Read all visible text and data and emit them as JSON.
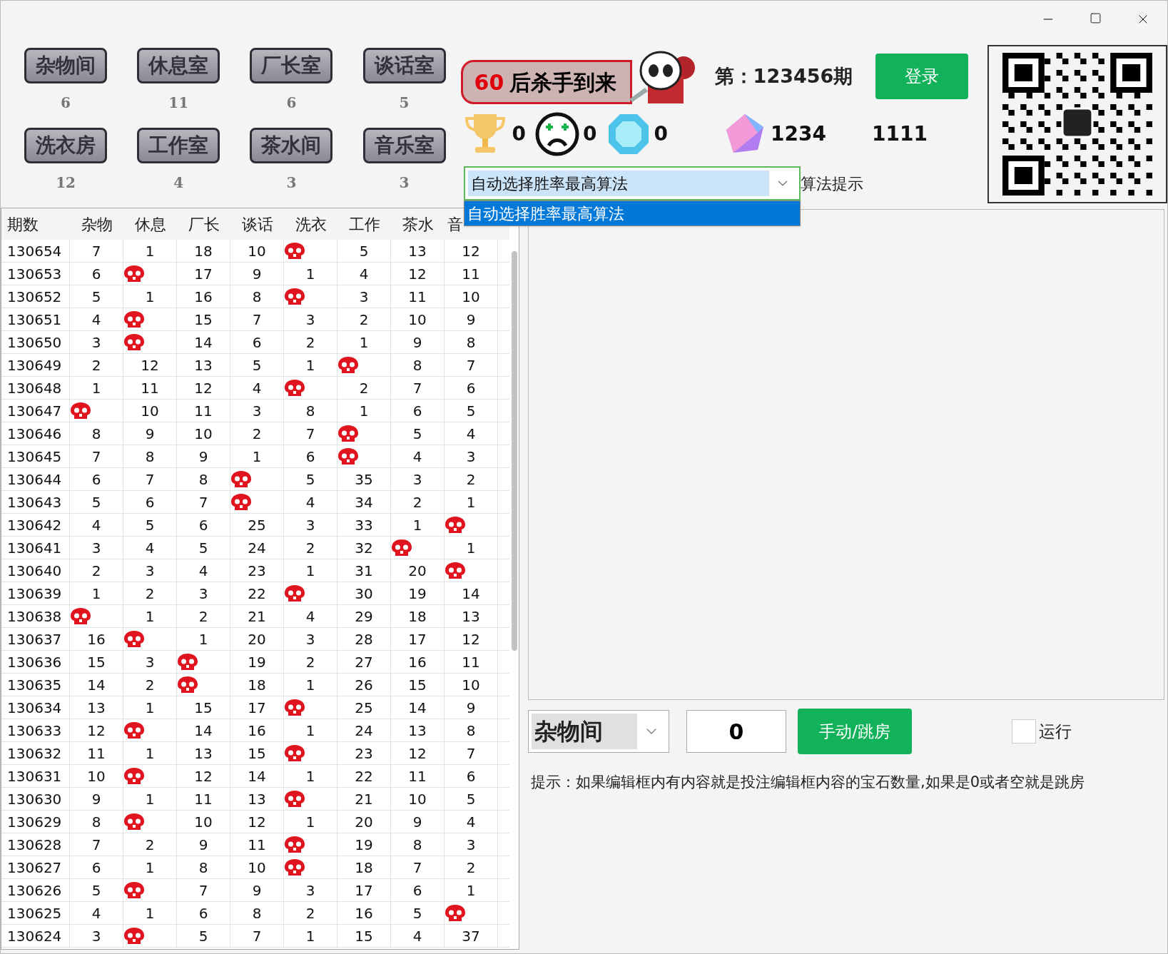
{
  "rooms": [
    {
      "label": "杂物间",
      "count": "6"
    },
    {
      "label": "休息室",
      "count": "11"
    },
    {
      "label": "厂长室",
      "count": "6"
    },
    {
      "label": "谈话室",
      "count": "5"
    },
    {
      "label": "洗衣房",
      "count": "12"
    },
    {
      "label": "工作室",
      "count": "4"
    },
    {
      "label": "茶水间",
      "count": "3"
    },
    {
      "label": "音乐室",
      "count": "3"
    }
  ],
  "banner": {
    "count": "60",
    "text": "后杀手到来"
  },
  "period": "第：123456期",
  "login_button": "登录",
  "stats": [
    {
      "kind": "trophy",
      "value": "0"
    },
    {
      "kind": "sad",
      "value": "0"
    },
    {
      "kind": "gem",
      "value": "0"
    },
    {
      "kind": "crystal",
      "value": "1234"
    }
  ],
  "extra_value": "1111",
  "algorithm": {
    "value": "自动选择胜率最高算法",
    "label": "算法提示",
    "options": [
      {
        "label": "自动选择胜率最高算法",
        "selected": true
      }
    ]
  },
  "table": {
    "columns": [
      "期数",
      "杂物",
      "休息",
      "厂长",
      "谈话",
      "洗衣",
      "工作",
      "茶水",
      "音"
    ],
    "rows": [
      {
        "cells": [
          "130654",
          "7",
          "1",
          "18",
          "10",
          {
            "kind": "skull"
          },
          "5",
          "13",
          "12"
        ]
      },
      {
        "cells": [
          "130653",
          "6",
          {
            "kind": "skull"
          },
          "17",
          "9",
          "1",
          "4",
          "12",
          "11"
        ]
      },
      {
        "cells": [
          "130652",
          "5",
          "1",
          "16",
          "8",
          {
            "kind": "skull"
          },
          "3",
          "11",
          "10"
        ]
      },
      {
        "cells": [
          "130651",
          "4",
          {
            "kind": "skull"
          },
          "15",
          "7",
          "3",
          "2",
          "10",
          "9"
        ]
      },
      {
        "cells": [
          "130650",
          "3",
          {
            "kind": "skull"
          },
          "14",
          "6",
          "2",
          "1",
          "9",
          "8"
        ]
      },
      {
        "cells": [
          "130649",
          "2",
          "12",
          "13",
          "5",
          "1",
          {
            "kind": "skull"
          },
          "8",
          "7"
        ]
      },
      {
        "cells": [
          "130648",
          "1",
          "11",
          "12",
          "4",
          {
            "kind": "skull"
          },
          "2",
          "7",
          "6"
        ]
      },
      {
        "cells": [
          "130647",
          {
            "kind": "skull"
          },
          "10",
          "11",
          "3",
          "8",
          "1",
          "6",
          "5"
        ]
      },
      {
        "cells": [
          "130646",
          "8",
          "9",
          "10",
          "2",
          "7",
          {
            "kind": "skull"
          },
          "5",
          "4"
        ]
      },
      {
        "cells": [
          "130645",
          "7",
          "8",
          "9",
          "1",
          "6",
          {
            "kind": "skull"
          },
          "4",
          "3"
        ]
      },
      {
        "cells": [
          "130644",
          "6",
          "7",
          "8",
          {
            "kind": "skull"
          },
          "5",
          "35",
          "3",
          "2"
        ]
      },
      {
        "cells": [
          "130643",
          "5",
          "6",
          "7",
          {
            "kind": "skull"
          },
          "4",
          "34",
          "2",
          "1"
        ]
      },
      {
        "cells": [
          "130642",
          "4",
          "5",
          "6",
          "25",
          "3",
          "33",
          "1",
          {
            "kind": "skull"
          }
        ]
      },
      {
        "cells": [
          "130641",
          "3",
          "4",
          "5",
          "24",
          "2",
          "32",
          {
            "kind": "skull"
          },
          "1"
        ]
      },
      {
        "cells": [
          "130640",
          "2",
          "3",
          "4",
          "23",
          "1",
          "31",
          "20",
          {
            "kind": "skull"
          }
        ]
      },
      {
        "cells": [
          "130639",
          "1",
          "2",
          "3",
          "22",
          {
            "kind": "skull"
          },
          "30",
          "19",
          "14"
        ]
      },
      {
        "cells": [
          "130638",
          {
            "kind": "skull"
          },
          "1",
          "2",
          "21",
          "4",
          "29",
          "18",
          "13"
        ]
      },
      {
        "cells": [
          "130637",
          "16",
          {
            "kind": "skull"
          },
          "1",
          "20",
          "3",
          "28",
          "17",
          "12"
        ]
      },
      {
        "cells": [
          "130636",
          "15",
          "3",
          {
            "kind": "skull"
          },
          "19",
          "2",
          "27",
          "16",
          "11"
        ]
      },
      {
        "cells": [
          "130635",
          "14",
          "2",
          {
            "kind": "skull"
          },
          "18",
          "1",
          "26",
          "15",
          "10"
        ]
      },
      {
        "cells": [
          "130634",
          "13",
          "1",
          "15",
          "17",
          {
            "kind": "skull"
          },
          "25",
          "14",
          "9"
        ]
      },
      {
        "cells": [
          "130633",
          "12",
          {
            "kind": "skull"
          },
          "14",
          "16",
          "1",
          "24",
          "13",
          "8"
        ]
      },
      {
        "cells": [
          "130632",
          "11",
          "1",
          "13",
          "15",
          {
            "kind": "skull"
          },
          "23",
          "12",
          "7"
        ]
      },
      {
        "cells": [
          "130631",
          "10",
          {
            "kind": "skull"
          },
          "12",
          "14",
          "1",
          "22",
          "11",
          "6"
        ]
      },
      {
        "cells": [
          "130630",
          "9",
          "1",
          "11",
          "13",
          {
            "kind": "skull"
          },
          "21",
          "10",
          "5"
        ]
      },
      {
        "cells": [
          "130629",
          "8",
          {
            "kind": "skull"
          },
          "10",
          "12",
          "1",
          "20",
          "9",
          "4"
        ]
      },
      {
        "cells": [
          "130628",
          "7",
          "2",
          "9",
          "11",
          {
            "kind": "skull"
          },
          "19",
          "8",
          "3"
        ]
      },
      {
        "cells": [
          "130627",
          "6",
          "1",
          "8",
          "10",
          {
            "kind": "skull"
          },
          "18",
          "7",
          "2"
        ]
      },
      {
        "cells": [
          "130626",
          "5",
          {
            "kind": "skull"
          },
          "7",
          "9",
          "3",
          "17",
          "6",
          "1"
        ]
      },
      {
        "cells": [
          "130625",
          "4",
          "1",
          "6",
          "8",
          "2",
          "16",
          "5",
          {
            "kind": "skull"
          }
        ]
      },
      {
        "cells": [
          "130624",
          "3",
          {
            "kind": "skull"
          },
          "5",
          "7",
          "1",
          "15",
          "4",
          "37"
        ]
      }
    ]
  },
  "controls": {
    "room": "杂物间",
    "amount": "0",
    "action_button": "手动/跳房",
    "run": {
      "label": "运行",
      "checked": false
    }
  },
  "hint": "提示：如果编辑框内有内容就是投注编辑框内容的宝石数量,如果是0或者空就是跳房"
}
